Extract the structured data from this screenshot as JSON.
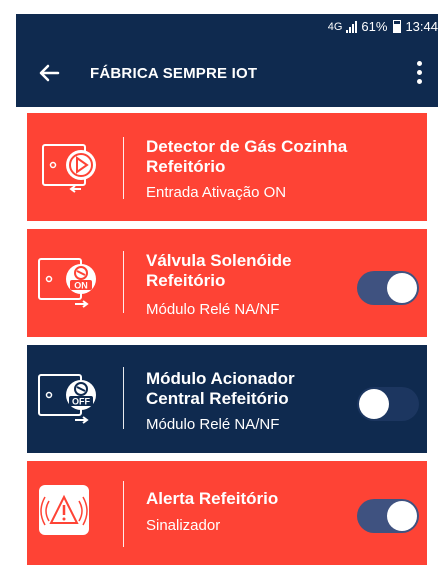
{
  "status_bar": {
    "network": "4G",
    "battery": "61%",
    "time": "13:44"
  },
  "app_bar": {
    "title": "FÁBRICA SEMPRE IOT"
  },
  "devices": [
    {
      "title_line1": "Detector de Gás Cozinha",
      "title_line2": "Refeitório",
      "subtitle": "Entrada Ativação ON",
      "icon": "gas-sensor-icon"
    },
    {
      "title_line1": "Válvula Solenóide",
      "title_line2": "Refeitório",
      "subtitle": "Módulo Relé NA/NF",
      "icon": "relay-on-icon",
      "badge": "ON",
      "toggle_on": true
    },
    {
      "title_line1": "Módulo Acionador",
      "title_line2": "Central Refeitório",
      "subtitle": "Módulo Relé NA/NF",
      "icon": "relay-off-icon",
      "badge": "OFF",
      "toggle_on": false
    },
    {
      "title_line1": "Alerta Refeitório",
      "subtitle": "Sinalizador",
      "icon": "alarm-siren-icon",
      "toggle_on": true
    }
  ],
  "colors": {
    "primary": "#0f2a4f",
    "alert_red": "#fe4335",
    "toggle_on": "#3f5280"
  }
}
